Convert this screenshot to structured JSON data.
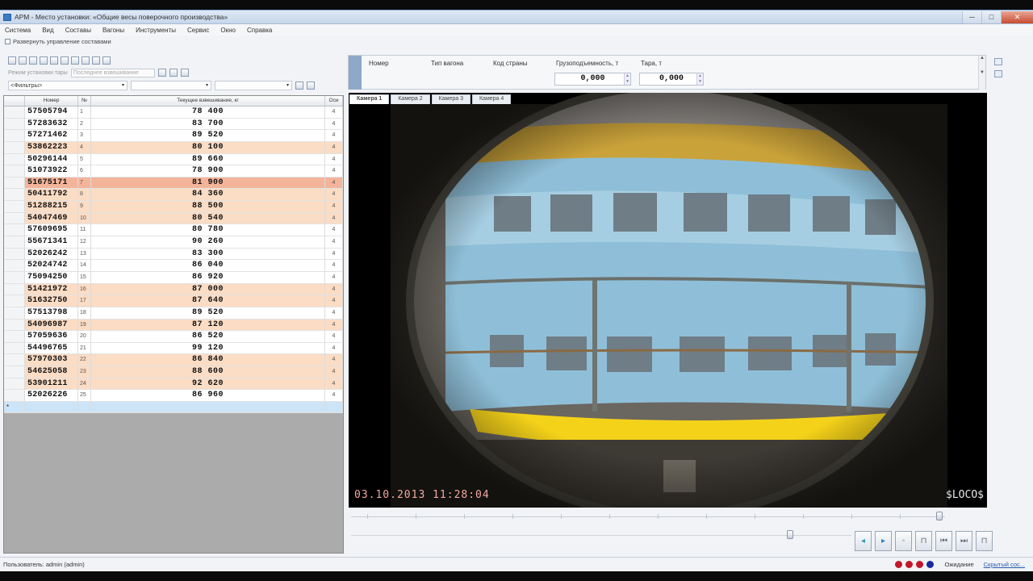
{
  "window": {
    "title": "АРМ - Место установки: «Общие весы поверочного производства»",
    "min_glyph": "─",
    "max_glyph": "□",
    "close_glyph": "✕"
  },
  "menu": [
    "Система",
    "Вид",
    "Составы",
    "Вагоны",
    "Инструменты",
    "Сервис",
    "Окно",
    "Справка"
  ],
  "collapse_label": "Развернуть управление составами",
  "toolbar2": {
    "mode_label": "Режим установки тары",
    "mode_value": "Последнее взвешивание"
  },
  "filter": {
    "placeholder": "<Фильтры>",
    "arrow": "▾"
  },
  "grid": {
    "columns": [
      "",
      "Номер",
      "№",
      "Текущее взвешивание, кг",
      "Оси"
    ],
    "rows": [
      {
        "num": "57505794",
        "n": "1",
        "w": "78 400",
        "ax": "4",
        "hl": ""
      },
      {
        "num": "57283632",
        "n": "2",
        "w": "83 700",
        "ax": "4",
        "hl": ""
      },
      {
        "num": "57271462",
        "n": "3",
        "w": "89 520",
        "ax": "4",
        "hl": ""
      },
      {
        "num": "53862223",
        "n": "4",
        "w": "80 100",
        "ax": "4",
        "hl": "hl"
      },
      {
        "num": "50296144",
        "n": "5",
        "w": "89 660",
        "ax": "4",
        "hl": ""
      },
      {
        "num": "51073922",
        "n": "6",
        "w": "78 900",
        "ax": "4",
        "hl": ""
      },
      {
        "num": "51675171",
        "n": "7",
        "w": "81 900",
        "ax": "4",
        "hl": "hl2"
      },
      {
        "num": "50411792",
        "n": "8",
        "w": "84 360",
        "ax": "4",
        "hl": "hl"
      },
      {
        "num": "51288215",
        "n": "9",
        "w": "88 500",
        "ax": "4",
        "hl": "hl"
      },
      {
        "num": "54047469",
        "n": "10",
        "w": "80 540",
        "ax": "4",
        "hl": "hl"
      },
      {
        "num": "57609695",
        "n": "11",
        "w": "80 780",
        "ax": "4",
        "hl": ""
      },
      {
        "num": "55671341",
        "n": "12",
        "w": "90 260",
        "ax": "4",
        "hl": ""
      },
      {
        "num": "52026242",
        "n": "13",
        "w": "83 300",
        "ax": "4",
        "hl": ""
      },
      {
        "num": "52024742",
        "n": "14",
        "w": "86 040",
        "ax": "4",
        "hl": ""
      },
      {
        "num": "75094250",
        "n": "15",
        "w": "86 920",
        "ax": "4",
        "hl": ""
      },
      {
        "num": "51421972",
        "n": "16",
        "w": "87 000",
        "ax": "4",
        "hl": "hl"
      },
      {
        "num": "51632750",
        "n": "17",
        "w": "87 640",
        "ax": "4",
        "hl": "hl"
      },
      {
        "num": "57513798",
        "n": "18",
        "w": "89 520",
        "ax": "4",
        "hl": ""
      },
      {
        "num": "54096987",
        "n": "19",
        "w": "87 120",
        "ax": "4",
        "hl": "hl"
      },
      {
        "num": "57059636",
        "n": "20",
        "w": "86 520",
        "ax": "4",
        "hl": ""
      },
      {
        "num": "54496765",
        "n": "21",
        "w": "99 120",
        "ax": "4",
        "hl": ""
      },
      {
        "num": "57970303",
        "n": "22",
        "w": "86 840",
        "ax": "4",
        "hl": "hl"
      },
      {
        "num": "54625058",
        "n": "23",
        "w": "88 600",
        "ax": "4",
        "hl": "hl"
      },
      {
        "num": "53901211",
        "n": "24",
        "w": "92 620",
        "ax": "4",
        "hl": "hl"
      },
      {
        "num": "52026226",
        "n": "25",
        "w": "86 960",
        "ax": "4",
        "hl": ""
      }
    ],
    "new_row_marker": "*"
  },
  "info": {
    "number_label": "Номер",
    "wagon_type_label": "Тип вагона",
    "country_code_label": "Код страны",
    "capacity_label": "Грузоподъемность, т",
    "capacity_value": "0,000",
    "tare_label": "Тара, т",
    "tare_value": "0,000"
  },
  "tabs": [
    "Камера 1",
    "Камера 2",
    "Камера 3",
    "Камера 4"
  ],
  "video": {
    "timestamp": "03.10.2013 11:28:04",
    "brand": "$LOCO$"
  },
  "controls": [
    "◂",
    "▸",
    "◦",
    "⊓",
    "⏮",
    "⏭",
    "⊓"
  ],
  "status": {
    "user": "Пользователь: admin (admin)",
    "waiting": "Ожидание",
    "link": "Скрытый сос...",
    "dot_colors": [
      "#c4162a",
      "#c4162a",
      "#c4162a",
      "#1a2a9c"
    ]
  }
}
